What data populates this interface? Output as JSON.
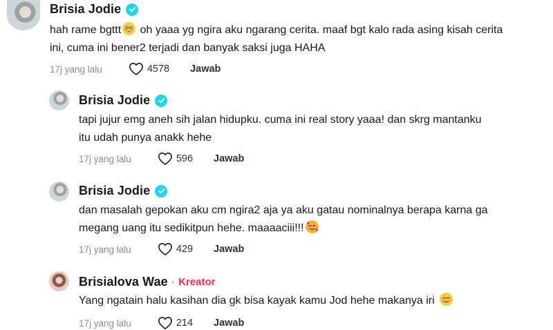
{
  "comments": [
    {
      "author": "Brisia Jodie",
      "text_1": "hah rame bgttt",
      "text_2": " oh yaaa yg ngira aku ngarang cerita. maaf bgt kalo rada asing kisah cerita ini, cuma ini bener2 terjadi dan banyak saksi juga HAHA",
      "time": "17j yang lalu",
      "likes": "4578",
      "reply": "Jawab"
    },
    {
      "author": "Brisia Jodie",
      "text": "tapi jujur emg aneh sih jalan hidupku. cuma ini real story yaaa! dan skrg mantanku itu udah punya anakk hehe",
      "time": "17j yang lalu",
      "likes": "596",
      "reply": "Jawab"
    },
    {
      "author": "Brisia Jodie",
      "text": "dan masalah gepokan aku cm ngira2 aja ya aku gatau nominalnya berapa karna ga megang uang itu sedikitpun hehe. maaaaciii!!!",
      "time": "17j yang lalu",
      "likes": "429",
      "reply": "Jawab"
    },
    {
      "author": "Brisialova Wae",
      "separator": "·",
      "badge": "Kreator",
      "text": "Yang ngatain halu kasihan dia gk bisa kayak kamu Jod hehe makanya iri",
      "time": "17j yang lalu",
      "likes": "214",
      "reply": "Jawab"
    }
  ],
  "colors": {
    "verified": "#20d5ec",
    "creator": "#fe2c55",
    "meta": "#8a8b91"
  },
  "icons": [
    "verified-icon",
    "heart-outline-icon",
    "flushed-face-emoji",
    "smiling-hearts-emoji",
    "blush-face-emoji"
  ]
}
